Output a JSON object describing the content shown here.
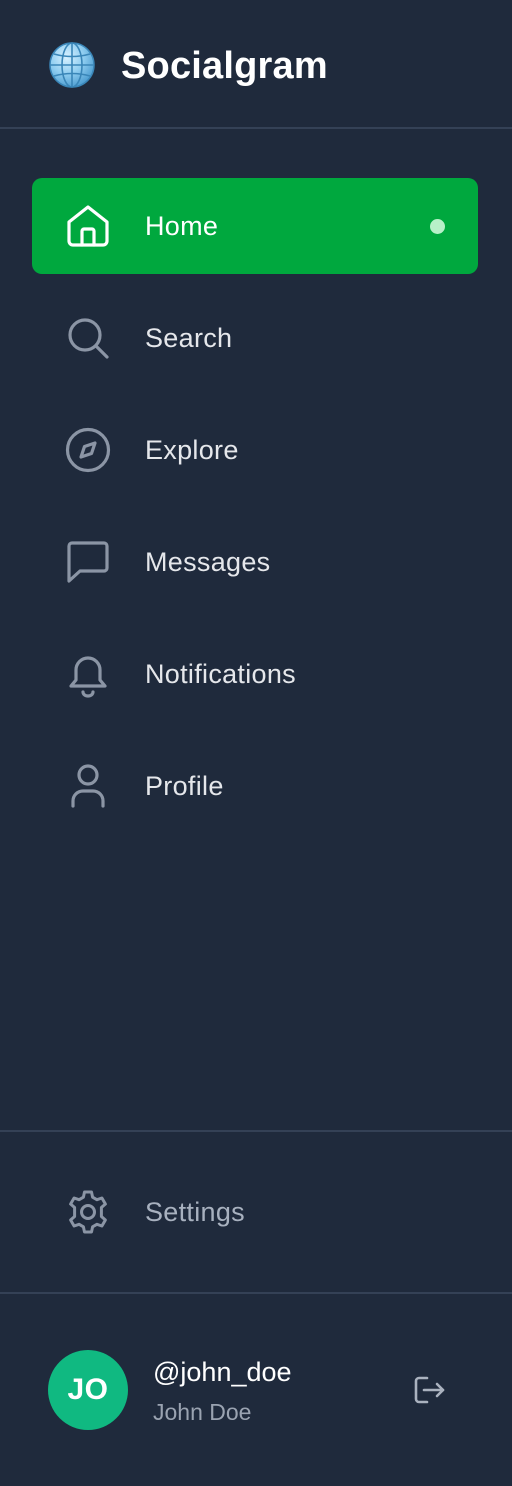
{
  "app": {
    "title": "Socialgram",
    "logo_icon": "globe-icon"
  },
  "colors": {
    "background": "#1f2a3c",
    "accent": "#00a83e",
    "avatar": "#10b981",
    "divider": "#344156"
  },
  "nav": {
    "items": [
      {
        "label": "Home",
        "icon": "home-icon",
        "active": true
      },
      {
        "label": "Search",
        "icon": "search-icon",
        "active": false
      },
      {
        "label": "Explore",
        "icon": "compass-icon",
        "active": false
      },
      {
        "label": "Messages",
        "icon": "message-icon",
        "active": false
      },
      {
        "label": "Notifications",
        "icon": "bell-icon",
        "active": false
      },
      {
        "label": "Profile",
        "icon": "user-icon",
        "active": false
      }
    ]
  },
  "settings": {
    "label": "Settings",
    "icon": "gear-icon"
  },
  "user": {
    "initials": "JO",
    "username": "@john_doe",
    "full_name": "John Doe",
    "logout_icon": "logout-icon"
  }
}
